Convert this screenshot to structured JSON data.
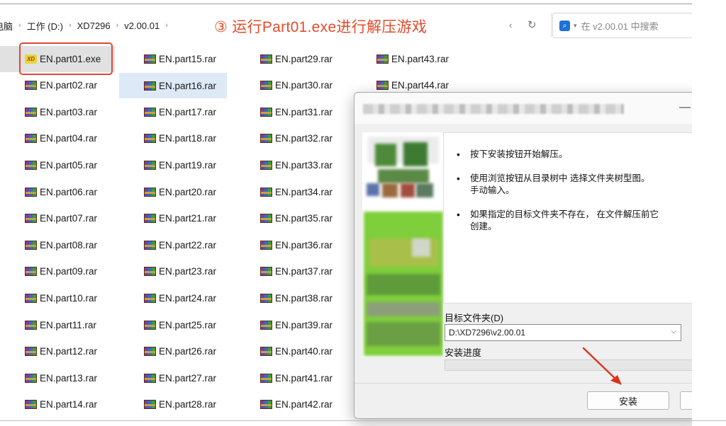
{
  "breadcrumb": {
    "items": [
      "电脑",
      "工作 (D:)",
      "XD7296",
      "v2.00.01"
    ],
    "separator": "›"
  },
  "annotation": {
    "text": "③ 运行Part01.exe进行解压游戏",
    "color": "#e24b2b"
  },
  "search": {
    "placeholder": "在 v2.00.01 中搜索"
  },
  "files": {
    "col1": [
      "EN.part01.exe",
      "EN.part02.rar",
      "EN.part03.rar",
      "EN.part04.rar",
      "EN.part05.rar",
      "EN.part06.rar",
      "EN.part07.rar",
      "EN.part08.rar",
      "EN.part09.rar",
      "EN.part10.rar",
      "EN.part11.rar",
      "EN.part12.rar",
      "EN.part13.rar",
      "EN.part14.rar"
    ],
    "col2": [
      "EN.part15.rar",
      "EN.part16.rar",
      "EN.part17.rar",
      "EN.part18.rar",
      "EN.part19.rar",
      "EN.part20.rar",
      "EN.part21.rar",
      "EN.part22.rar",
      "EN.part23.rar",
      "EN.part24.rar",
      "EN.part25.rar",
      "EN.part26.rar",
      "EN.part27.rar",
      "EN.part28.rar"
    ],
    "col3": [
      "EN.part29.rar",
      "EN.part30.rar",
      "EN.part31.rar",
      "EN.part32.rar",
      "EN.part33.rar",
      "EN.part34.rar",
      "EN.part35.rar",
      "EN.part36.rar",
      "EN.part37.rar",
      "EN.part38.rar",
      "EN.part39.rar",
      "EN.part40.rar",
      "EN.part41.rar",
      "EN.part42.rar"
    ],
    "col4": [
      "EN.part43.rar",
      "EN.part44.rar"
    ]
  },
  "installer": {
    "bullets": [
      "按下安装按钮开始解压。",
      "使用浏览按钮从目录树中 选择文件夹树型图。",
      "手动输入。",
      "如果指定的目标文件夹不存在， 在文件解压前它",
      "创建。"
    ],
    "dest_label": "目标文件夹(D)",
    "dest_path": "D:\\XD7296\\v2.00.01",
    "progress_label": "安装进度",
    "progress": 0,
    "install_label": "安装"
  }
}
